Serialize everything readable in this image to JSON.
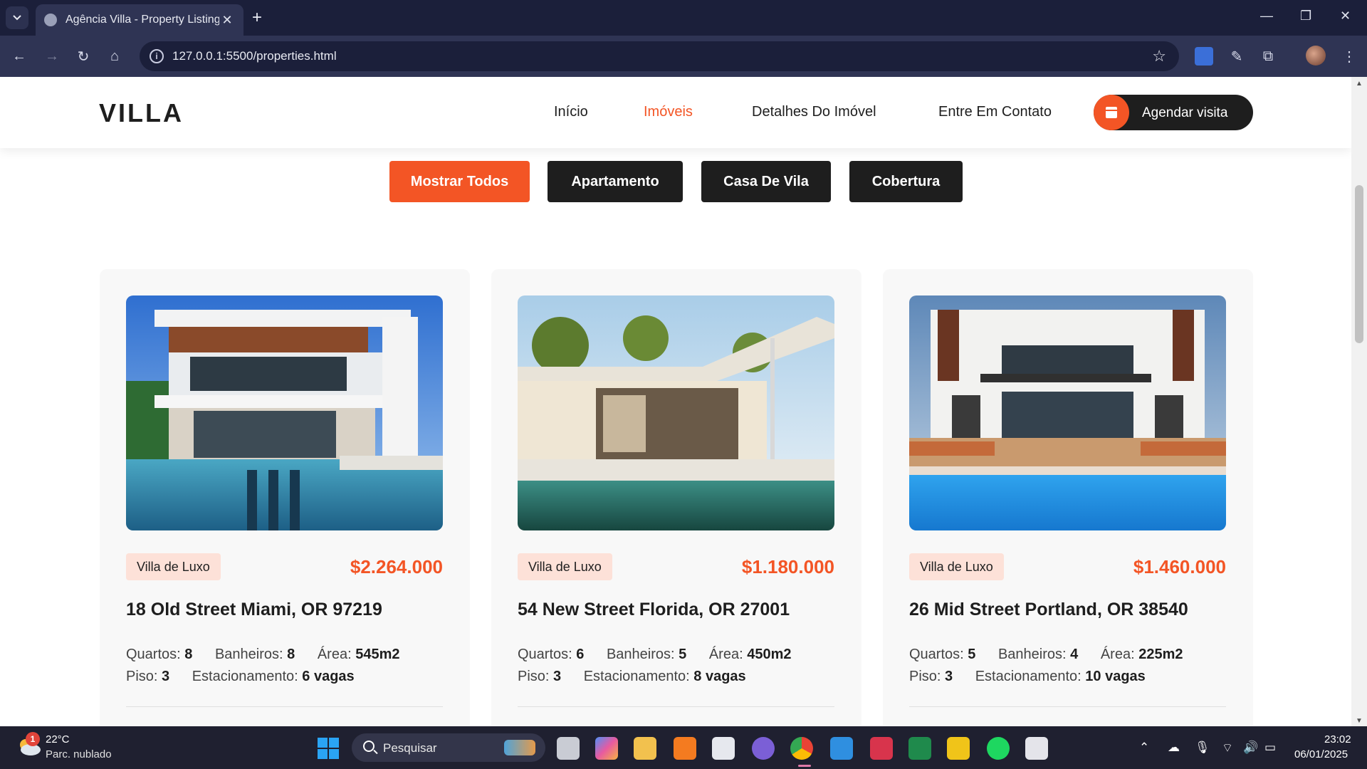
{
  "browser": {
    "tab_title": "Agência Villa - Property Listing",
    "url": "127.0.0.1:5500/properties.html"
  },
  "site": {
    "logo": "VILLA",
    "nav": [
      {
        "label": "Início",
        "active": false
      },
      {
        "label": "Imóveis",
        "active": true
      },
      {
        "label": "Detalhes Do Imóvel",
        "active": false
      },
      {
        "label": "Entre Em Contato",
        "active": false
      }
    ],
    "cta_label": "Agendar visita",
    "accent_color": "#f35525",
    "dark_color": "#1e1e1e"
  },
  "filters": [
    {
      "label": "Mostrar Todos",
      "active": true
    },
    {
      "label": "Apartamento",
      "active": false
    },
    {
      "label": "Casa De Vila",
      "active": false
    },
    {
      "label": "Cobertura",
      "active": false
    }
  ],
  "properties": [
    {
      "category": "Villa de Luxo",
      "price": "$2.264.000",
      "address": "18 Old Street Miami, OR 97219",
      "quartos_label": "Quartos:",
      "quartos": "8",
      "banheiros_label": "Banheiros:",
      "banheiros": "8",
      "area_label": "Área:",
      "area": "545m2",
      "piso_label": "Piso:",
      "piso": "3",
      "estacionamento_label": "Estacionamento:",
      "estacionamento": "6 vagas"
    },
    {
      "category": "Villa de Luxo",
      "price": "$1.180.000",
      "address": "54 New Street Florida, OR 27001",
      "quartos_label": "Quartos:",
      "quartos": "6",
      "banheiros_label": "Banheiros:",
      "banheiros": "5",
      "area_label": "Área:",
      "area": "450m2",
      "piso_label": "Piso:",
      "piso": "3",
      "estacionamento_label": "Estacionamento:",
      "estacionamento": "8 vagas"
    },
    {
      "category": "Villa de Luxo",
      "price": "$1.460.000",
      "address": "26 Mid Street Portland, OR 38540",
      "quartos_label": "Quartos:",
      "quartos": "5",
      "banheiros_label": "Banheiros:",
      "banheiros": "4",
      "area_label": "Área:",
      "area": "225m2",
      "piso_label": "Piso:",
      "piso": "3",
      "estacionamento_label": "Estacionamento:",
      "estacionamento": "10 vagas"
    }
  ],
  "taskbar": {
    "weather_temp": "22°C",
    "weather_desc": "Parc. nublado",
    "weather_badge": "1",
    "search_placeholder": "Pesquisar",
    "time": "23:02",
    "date": "06/01/2025"
  }
}
